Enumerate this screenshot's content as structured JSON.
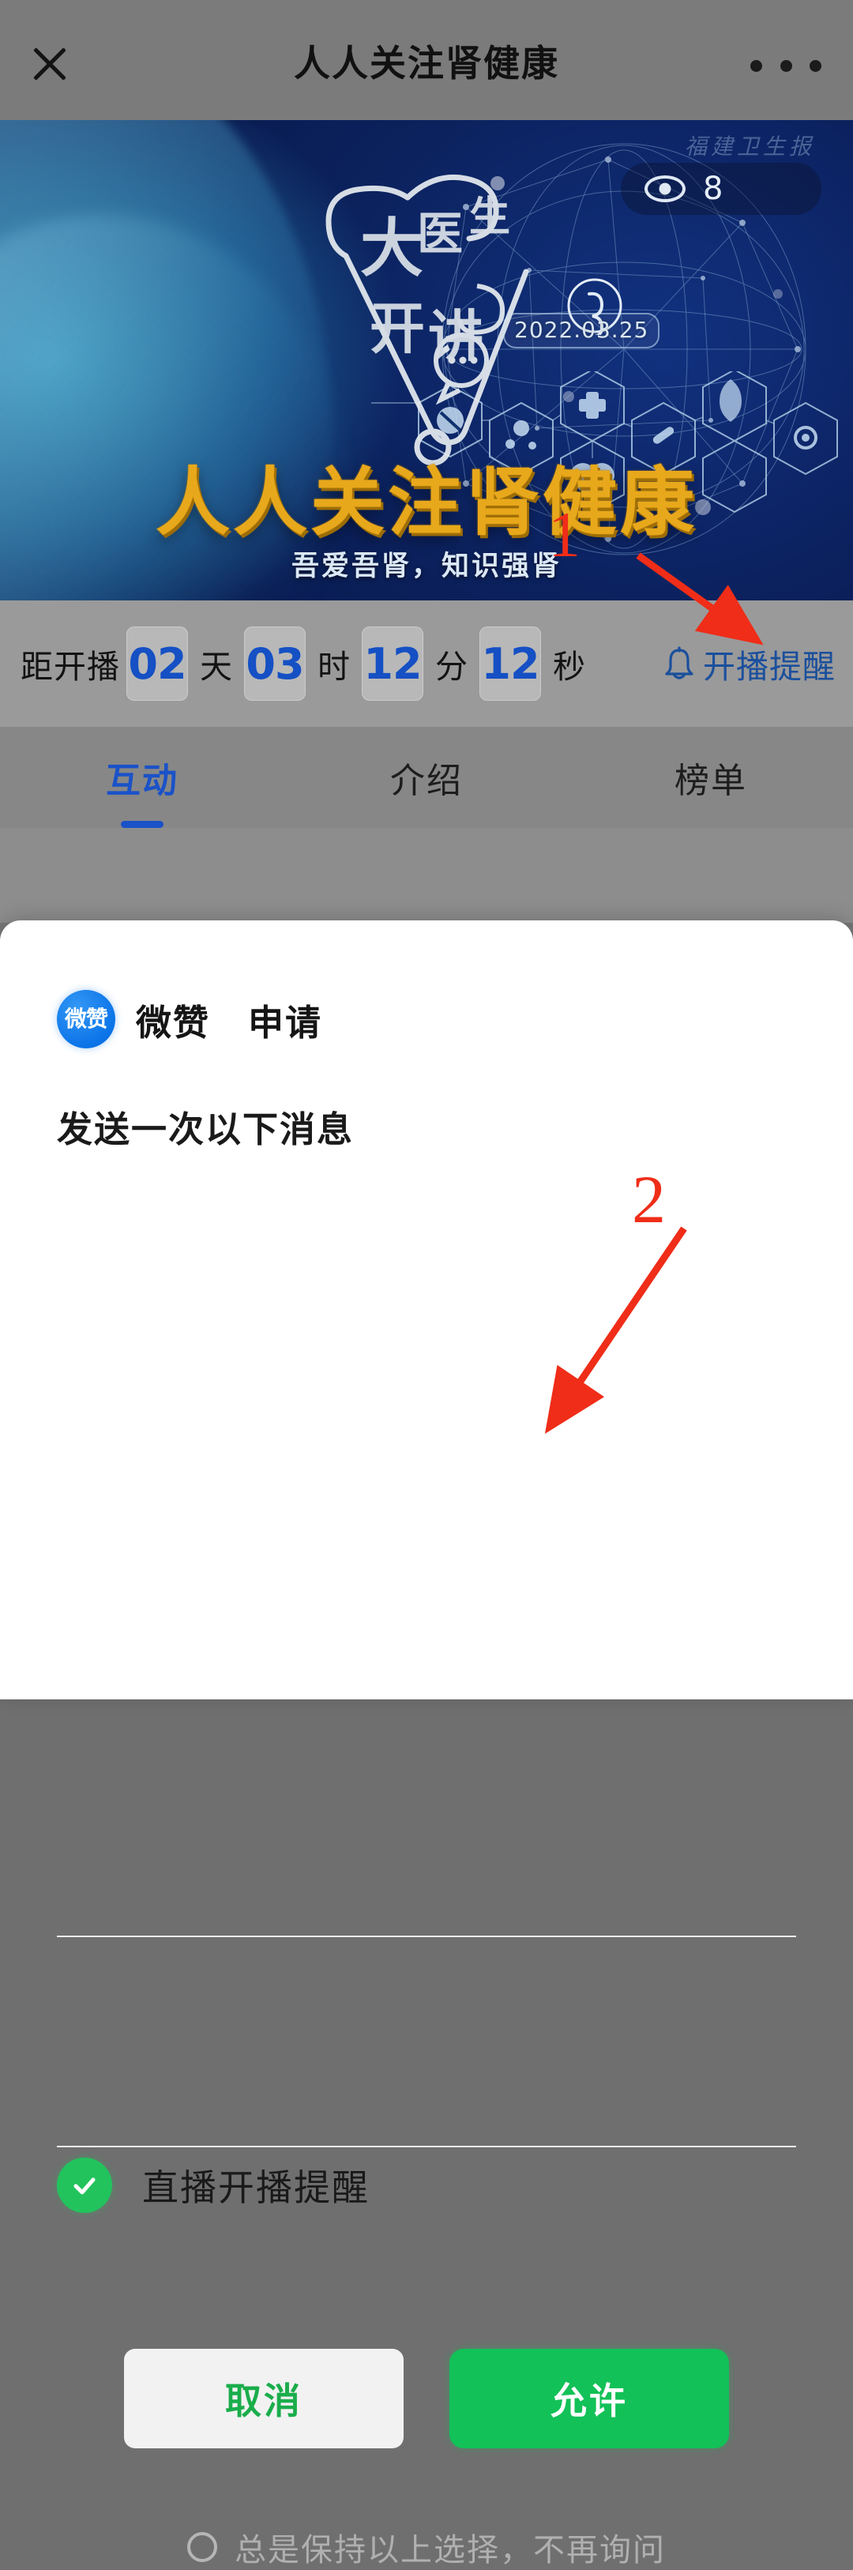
{
  "navbar": {
    "close_icon": "close-icon",
    "title": "人人关注肾健康",
    "more_icon": "more-options-icon"
  },
  "banner": {
    "watermark": "福建卫生报",
    "logo_text_line1": "大医生",
    "logo_text_line2": "开讲",
    "date_tag": "2022.03.25",
    "title": "人人关注肾健康",
    "subtitle": "吾爱吾肾，知识强肾",
    "viewer_icon": "eye-icon",
    "viewer_count": "8",
    "wechat_icon": "wechat-channels-icon"
  },
  "countdown": {
    "label": "距开播",
    "units": [
      {
        "value": "02",
        "unit": "天"
      },
      {
        "value": "03",
        "unit": "时"
      },
      {
        "value": "12",
        "unit": "分"
      },
      {
        "value": "12",
        "unit": "秒"
      }
    ],
    "remind_icon": "bell-icon",
    "remind_label": "开播提醒",
    "accent_color": "#1550c4"
  },
  "tabs": [
    {
      "label": "互动",
      "active": true
    },
    {
      "label": "介绍",
      "active": false
    },
    {
      "label": "榜单",
      "active": false
    }
  ],
  "dialog": {
    "app_logo_text": "微赞",
    "app_name": "微赞",
    "action": "申请",
    "section_title": "发送一次以下消息",
    "messages": [
      {
        "label": "直播开播提醒",
        "checked": true,
        "check_icon": "check-circle-icon"
      }
    ],
    "buttons": {
      "cancel": "取消",
      "allow": "允许"
    },
    "keep_choice": {
      "radio_icon": "radio-unchecked-icon",
      "label": "总是保持以上选择，不再询问"
    },
    "allow_color": "#12c157",
    "cancel_text_color": "#1aad4b"
  },
  "annotations": [
    {
      "number": "1",
      "color": "#ef2d18"
    },
    {
      "number": "2",
      "color": "#ef2d18"
    }
  ]
}
